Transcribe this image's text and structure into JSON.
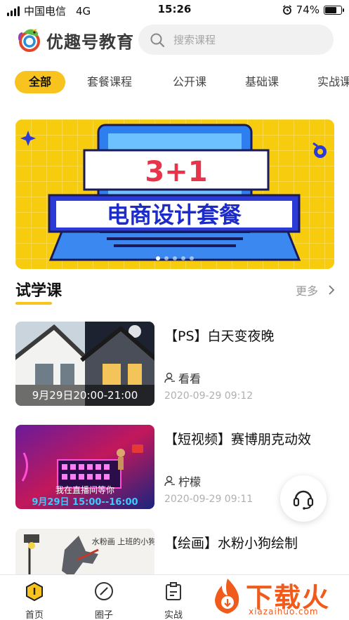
{
  "status_bar": {
    "carrier": "中国电信",
    "network": "4G",
    "time": "15:26",
    "battery": "74%",
    "battery_level": 0.74
  },
  "header": {
    "logo_text": "优趣号教育",
    "search_placeholder": "搜索课程"
  },
  "tabs": [
    {
      "label": "全部",
      "active": true
    },
    {
      "label": "套餐课程",
      "active": false
    },
    {
      "label": "公开课",
      "active": false
    },
    {
      "label": "基础课",
      "active": false
    },
    {
      "label": "实战课",
      "active": false
    }
  ],
  "banner": {
    "headline": "3+1",
    "subline": "电商设计套餐",
    "slides": 5,
    "current_slide": 1
  },
  "section": {
    "title": "试学课",
    "more_label": "更多"
  },
  "courses": [
    {
      "title": "【PS】白天变夜晚",
      "author": "看看",
      "date": "2020-09-29 09:12",
      "thumb_caption": "9月29日20:00-21:00",
      "thumb_icon": "house-day-night-image"
    },
    {
      "title": "【短视频】赛博朋克动效",
      "author": "柠檬",
      "date": "2020-09-29 09:11",
      "thumb_caption": "9月29日 15:00--16:00",
      "thumb_overlay": "我在直播间等你",
      "thumb_icon": "cyberpunk-image"
    },
    {
      "title": "【绘画】水粉小狗绘制",
      "author": "",
      "date": "",
      "thumb_caption": "",
      "thumb_overlay": "水粉画 上班的小狗狗",
      "thumb_icon": "dog-painting-image"
    }
  ],
  "bottom_nav": [
    {
      "label": "首页",
      "icon": "home-icon",
      "active": true
    },
    {
      "label": "圈子",
      "icon": "compass-icon",
      "active": false
    },
    {
      "label": "实战",
      "icon": "clipboard-icon",
      "active": false
    }
  ],
  "watermark": {
    "text": "下载火",
    "sub": "xiazaihuo.com"
  },
  "colors": {
    "accent": "#f8c21f",
    "banner_bg": "#f7cc0f",
    "muted_text": "#b0b0b0",
    "watermark": "#f05a1a"
  }
}
